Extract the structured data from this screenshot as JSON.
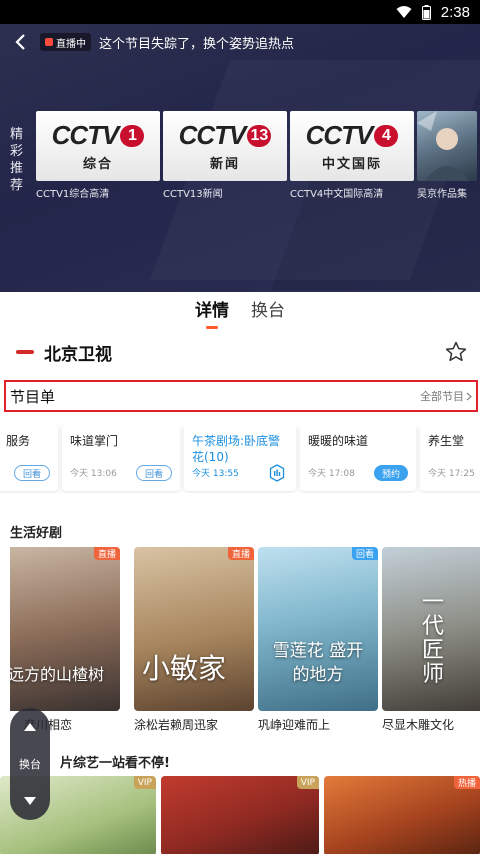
{
  "status_bar": {
    "time": "2:38"
  },
  "player": {
    "live_badge": "直播中",
    "message": "这个节目失踪了，换个姿势追热点"
  },
  "recommend": {
    "title": "精彩推荐",
    "items": [
      {
        "logo_word": "CCTV",
        "logo_num": "1",
        "logo_sub": "综合",
        "label": "CCTV1综合高清"
      },
      {
        "logo_word": "CCTV",
        "logo_num": "13",
        "logo_sub": "新闻",
        "label": "CCTV13新闻"
      },
      {
        "logo_word": "CCTV",
        "logo_num": "4",
        "logo_sub": "中文国际",
        "label": "CCTV4中文国际高清"
      },
      {
        "label": "吴京作品集"
      }
    ]
  },
  "tabs": [
    {
      "label": "详情",
      "active": true
    },
    {
      "label": "换台",
      "active": false
    }
  ],
  "channel": {
    "name": "北京卫视"
  },
  "schedule": {
    "title": "节目单",
    "all_label": "全部节目",
    "programs": [
      {
        "name": "服务",
        "time": "",
        "button": "回看"
      },
      {
        "name": "味道掌门",
        "time": "今天 13:06",
        "button": "回看"
      },
      {
        "name": "午茶剧场:卧底警花(10)",
        "time": "今天 13:55",
        "button": "",
        "current": true
      },
      {
        "name": "暖暖的味道",
        "time": "今天 17:08",
        "button": "预约"
      },
      {
        "name": "养生堂",
        "time": "今天 17:25",
        "button": ""
      }
    ]
  },
  "drama_section": {
    "title": "生活好剧",
    "items": [
      {
        "label": "彦川相恋",
        "tag": "直播",
        "calligraphy": "远方的山楂树"
      },
      {
        "label": "涂松岩赖周迅家",
        "tag": "直播",
        "calligraphy": "小敏家"
      },
      {
        "label": "巩峥迎难而上",
        "tag": "回看",
        "calligraphy": "雪莲花 盛开的地方"
      },
      {
        "label": "尽显木雕文化",
        "tag": "",
        "calligraphy": "一代匠师"
      }
    ]
  },
  "variety_section": {
    "title": "片综艺一站看不停!",
    "tags": [
      "VIP",
      "VIP",
      "热播"
    ]
  },
  "switch_float": {
    "label": "换台"
  },
  "colors": {
    "accent": "#ff5a2c",
    "highlight_border": "#e0202a",
    "current_program": "#1a8fe0",
    "tag_live": "#f0643c",
    "tag_replay": "#3aa2ef"
  }
}
